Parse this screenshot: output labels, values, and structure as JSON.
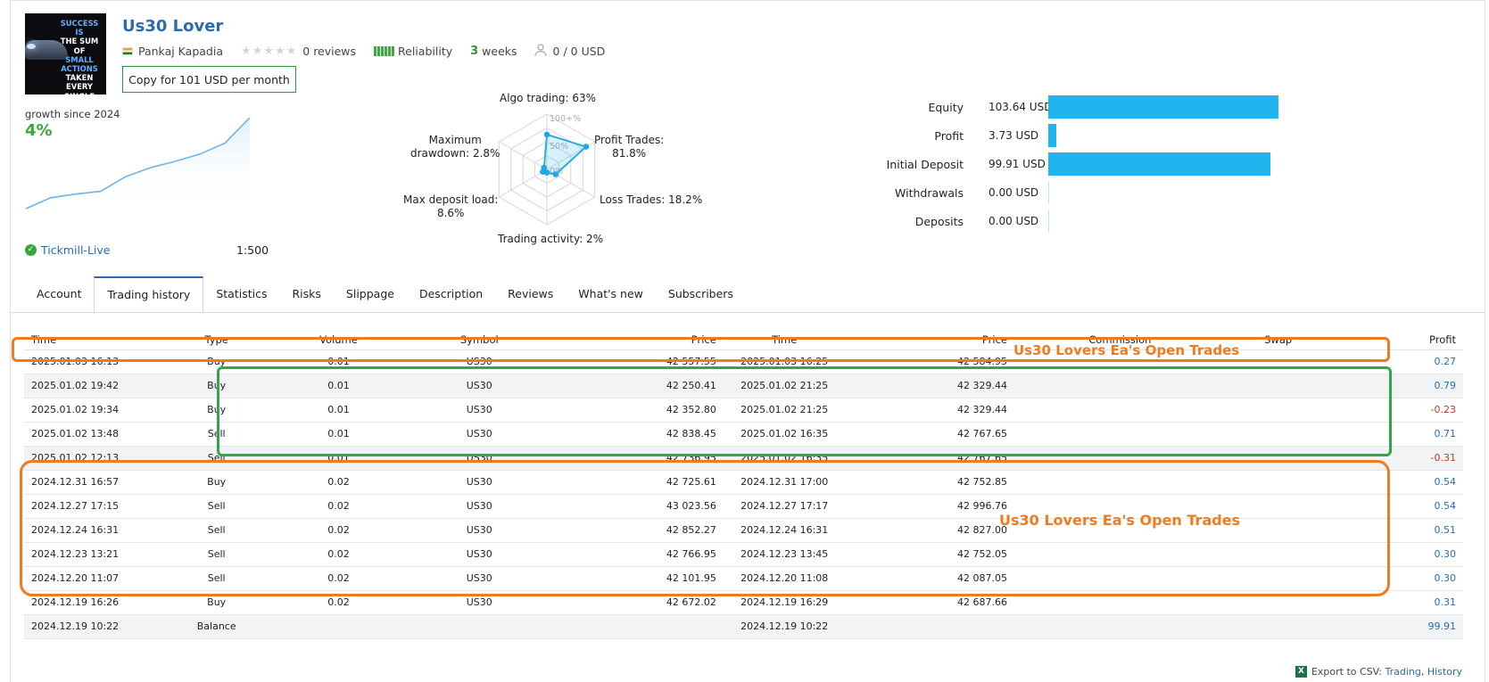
{
  "header": {
    "title": "Us30 Lover",
    "avatar_quote_lines": [
      "SUCCESS IS",
      "THE SUM OF",
      "SMALL",
      "ACTIONS",
      "TAKEN EVERY",
      "SINGLE DAY."
    ],
    "author": "Pankaj Kapadia",
    "reviews": "0 reviews",
    "reliability_label": "Reliability",
    "weeks_num": "3",
    "weeks_label": "weeks",
    "subscribers": "0 / 0 USD",
    "copy_button": "Copy for 101 USD per month"
  },
  "growth": {
    "label": "growth since 2024",
    "value": "4%",
    "points": [
      0.0,
      0.12,
      0.16,
      0.19,
      0.35,
      0.45,
      0.52,
      0.6,
      0.72,
      1.0
    ],
    "broker": "Tickmill-Live",
    "leverage": "1:500"
  },
  "radar": {
    "scale_labels": [
      "100+%",
      "50%",
      "0%"
    ],
    "axes": [
      {
        "line1": "Algo trading: 63%",
        "line2": "",
        "value": 0.63
      },
      {
        "line1": "Profit Trades:",
        "line2": "81.8%",
        "value": 0.818
      },
      {
        "line1": "Loss Trades: 18.2%",
        "line2": "",
        "value": 0.182
      },
      {
        "line1": "Trading activity: 2%",
        "line2": "",
        "value": 0.02
      },
      {
        "line1": "Max deposit load:",
        "line2": "8.6%",
        "value": 0.086
      },
      {
        "line1": "Maximum",
        "line2": "drawdown: 2.8%",
        "value": 0.028
      }
    ]
  },
  "balance": [
    {
      "name": "Equity",
      "value": "103.64 USD",
      "amount": 103.64
    },
    {
      "name": "Profit",
      "value": "3.73 USD",
      "amount": 3.73
    },
    {
      "name": "Initial Deposit",
      "value": "99.91 USD",
      "amount": 99.91
    },
    {
      "name": "Withdrawals",
      "value": "0.00 USD",
      "amount": 0
    },
    {
      "name": "Deposits",
      "value": "0.00 USD",
      "amount": 0
    }
  ],
  "tabs": [
    "Account",
    "Trading history",
    "Statistics",
    "Risks",
    "Slippage",
    "Description",
    "Reviews",
    "What's new",
    "Subscribers"
  ],
  "active_tab": "Trading history",
  "table": {
    "columns": [
      "Time",
      "Type",
      "Volume",
      "Symbol",
      "Price",
      "Time",
      "Price",
      "Commission",
      "Swap",
      "Profit"
    ],
    "rows": [
      [
        "2025.01.03 16:13",
        "Buy",
        "0.01",
        "US30",
        "42 557.55",
        "2025.01.03 16:25",
        "42 584.95",
        "",
        "",
        "0.27"
      ],
      [
        "2025.01.02 19:42",
        "Buy",
        "0.01",
        "US30",
        "42 250.41",
        "2025.01.02 21:25",
        "42 329.44",
        "",
        "",
        "0.79"
      ],
      [
        "2025.01.02 19:34",
        "Buy",
        "0.01",
        "US30",
        "42 352.80",
        "2025.01.02 21:25",
        "42 329.44",
        "",
        "",
        "-0.23"
      ],
      [
        "2025.01.02 13:48",
        "Sell",
        "0.01",
        "US30",
        "42 838.45",
        "2025.01.02 16:35",
        "42 767.65",
        "",
        "",
        "0.71"
      ],
      [
        "2025.01.02 12:13",
        "Sell",
        "0.01",
        "US30",
        "42 736.95",
        "2025.01.02 16:35",
        "42 767.65",
        "",
        "",
        "-0.31"
      ],
      [
        "2024.12.31 16:57",
        "Buy",
        "0.02",
        "US30",
        "42 725.61",
        "2024.12.31 17:00",
        "42 752.85",
        "",
        "",
        "0.54"
      ],
      [
        "2024.12.27 17:15",
        "Sell",
        "0.02",
        "US30",
        "43 023.56",
        "2024.12.27 17:17",
        "42 996.76",
        "",
        "",
        "0.54"
      ],
      [
        "2024.12.24 16:31",
        "Sell",
        "0.02",
        "US30",
        "42 852.27",
        "2024.12.24 16:31",
        "42 827.00",
        "",
        "",
        "0.51"
      ],
      [
        "2024.12.23 13:21",
        "Sell",
        "0.02",
        "US30",
        "42 766.95",
        "2024.12.23 13:45",
        "42 752.05",
        "",
        "",
        "0.30"
      ],
      [
        "2024.12.20 11:07",
        "Sell",
        "0.02",
        "US30",
        "42 101.95",
        "2024.12.20 11:08",
        "42 087.05",
        "",
        "",
        "0.30"
      ],
      [
        "2024.12.19 16:26",
        "Buy",
        "0.02",
        "US30",
        "42 672.02",
        "2024.12.19 16:29",
        "42 687.66",
        "",
        "",
        "0.31"
      ],
      [
        "2024.12.19 10:22",
        "Balance",
        "",
        "",
        "",
        "2024.12.19 10:22",
        "",
        "",
        "",
        "99.91"
      ]
    ]
  },
  "annotations": {
    "top": "Us30 Lovers Ea's Open Trades",
    "bottom": "Us30 Lovers Ea's Open Trades"
  },
  "export": {
    "label": "Export to CSV:",
    "trading": "Trading",
    "separator": ",",
    "history": "History"
  },
  "colors": {
    "accent_blue": "#2a6bb0",
    "bar_blue": "#20b5ef",
    "green": "#39a63b",
    "annotation_orange": "#f07b1f",
    "annotation_green": "#33a54a"
  }
}
